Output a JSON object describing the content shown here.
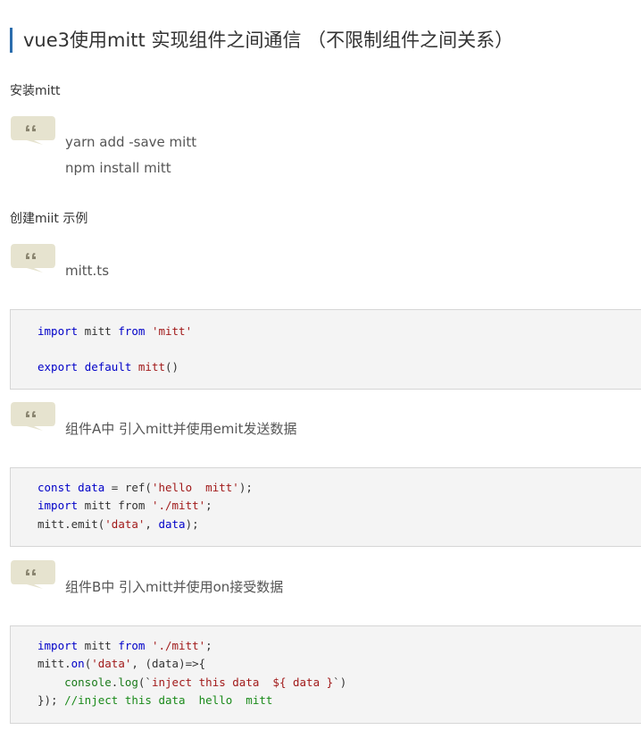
{
  "title": "vue3使用mitt 实现组件之间通信 （不限制组件之间关系）",
  "section1": {
    "heading": "安装mitt",
    "quote_lines": [
      "yarn add -save mitt",
      "npm install mitt"
    ]
  },
  "section2": {
    "heading": "创建miit 示例",
    "quote_lines": [
      "mitt.ts"
    ],
    "code": {
      "l1": {
        "a": "import",
        "b": " mitt ",
        "c": "from",
        "d": " ",
        "e": "'mitt'"
      },
      "l2": {
        "a": "export",
        "b": " ",
        "c": "default",
        "d": " ",
        "e": "mitt",
        "f": "()"
      }
    }
  },
  "section3": {
    "quote_lines": [
      "组件A中 引入mitt并使用emit发送数据"
    ],
    "code": {
      "l1": {
        "a": "const",
        "b": " ",
        "c": "data",
        "d": " = ref(",
        "e": "'hello  mitt'",
        "f": ");"
      },
      "l2": {
        "a": "import",
        "b": " mitt from ",
        "c": "'./mitt'",
        "d": ";"
      },
      "l3": {
        "a": "mitt.emit(",
        "b": "'data'",
        "c": ", ",
        "d": "data",
        "e": ");"
      }
    }
  },
  "section4": {
    "quote_lines": [
      "组件B中 引入mitt并使用on接受数据"
    ],
    "code": {
      "l1": {
        "a": "import",
        "b": " mitt ",
        "c": "from",
        "d": " ",
        "e": "'./mitt'",
        "f": ";"
      },
      "l2": {
        "a": "mitt.",
        "b": "on",
        "c": "(",
        "d": "'data'",
        "e": ", (data)=>{"
      },
      "l3": {
        "a": "    ",
        "b": "console",
        "c": ".",
        "d": "log",
        "e": "(`",
        "f": "inject this data  ${ data }",
        "g": "`)"
      },
      "l4": {
        "a": "}); ",
        "b": "//inject this data  hello  mitt"
      }
    }
  },
  "colors": {
    "accent_bar": "#2b6dad",
    "quote_icon": "#e6e3cf",
    "keyword": "#0000c8",
    "string": "#a11a1a",
    "comment": "#1a8a1a",
    "code_bg": "#f4f4f4"
  }
}
